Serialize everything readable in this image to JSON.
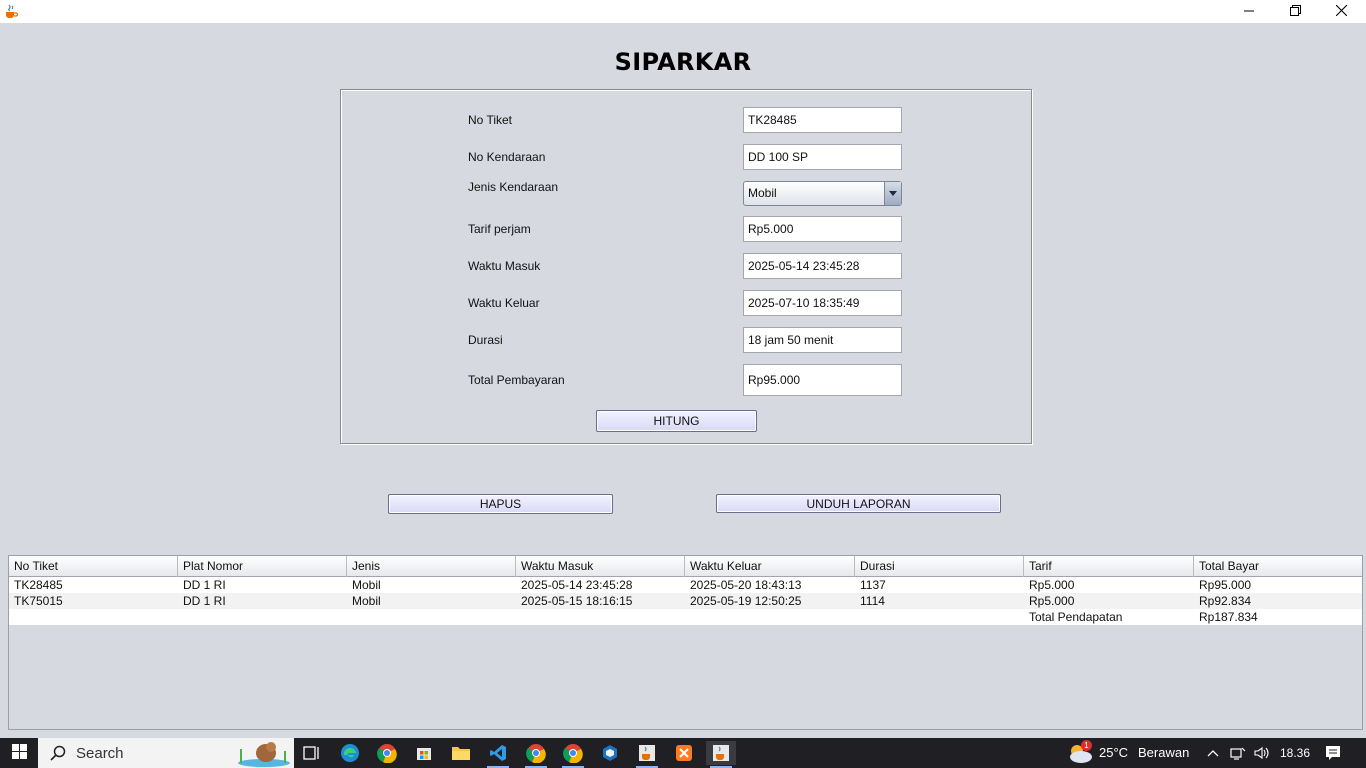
{
  "app": {
    "title": "SIPARKAR"
  },
  "form": {
    "no_tiket": {
      "label": "No Tiket",
      "value": "TK28485"
    },
    "no_kendaraan": {
      "label": "No Kendaraan",
      "value": "DD 100 SP"
    },
    "jenis_kendaraan": {
      "label": "Jenis Kendaraan",
      "value": "Mobil"
    },
    "tarif": {
      "label": "Tarif perjam",
      "value": "Rp5.000"
    },
    "waktu_masuk": {
      "label": "Waktu Masuk",
      "value": "2025-05-14 23:45:28"
    },
    "waktu_keluar": {
      "label": "Waktu Keluar",
      "value": "2025-07-10 18:35:49"
    },
    "durasi": {
      "label": "Durasi",
      "value": "18 jam 50 menit"
    },
    "total": {
      "label": "Total Pembayaran",
      "value": "Rp95.000"
    },
    "hitung_label": "HITUNG"
  },
  "actions": {
    "hapus_label": "HAPUS",
    "unduh_label": "UNDUH LAPORAN"
  },
  "table": {
    "columns": [
      "No Tiket",
      "Plat Nomor",
      "Jenis",
      "Waktu Masuk",
      "Waktu Keluar",
      "Durasi",
      "Tarif",
      "Total Bayar"
    ],
    "rows": [
      [
        "TK28485",
        "DD 1 RI",
        "Mobil",
        "2025-05-14 23:45:28",
        "2025-05-20 18:43:13",
        "1137",
        "Rp5.000",
        "Rp95.000"
      ],
      [
        "TK75015",
        "DD 1 RI",
        "Mobil",
        "2025-05-15 18:16:15",
        "2025-05-19 12:50:25",
        "1114",
        "Rp5.000",
        "Rp92.834"
      ],
      [
        "",
        "",
        "",
        "",
        "",
        "",
        "Total Pendapatan",
        "Rp187.834"
      ]
    ]
  },
  "taskbar": {
    "search_label": "Search",
    "weather_temp": "25°C",
    "weather_text": "Berawan",
    "weather_badge": "1",
    "time": "18.36"
  },
  "icons": {
    "app": "java-cup-icon",
    "minimize": "minimize-icon",
    "maximize": "restore-icon",
    "close": "close-icon",
    "dropdown": "chevron-down-icon"
  },
  "colors": {
    "window_bg": "#d6d9df",
    "button_bg": "#dcdcf8",
    "taskbar_bg": "#1f1f24"
  }
}
